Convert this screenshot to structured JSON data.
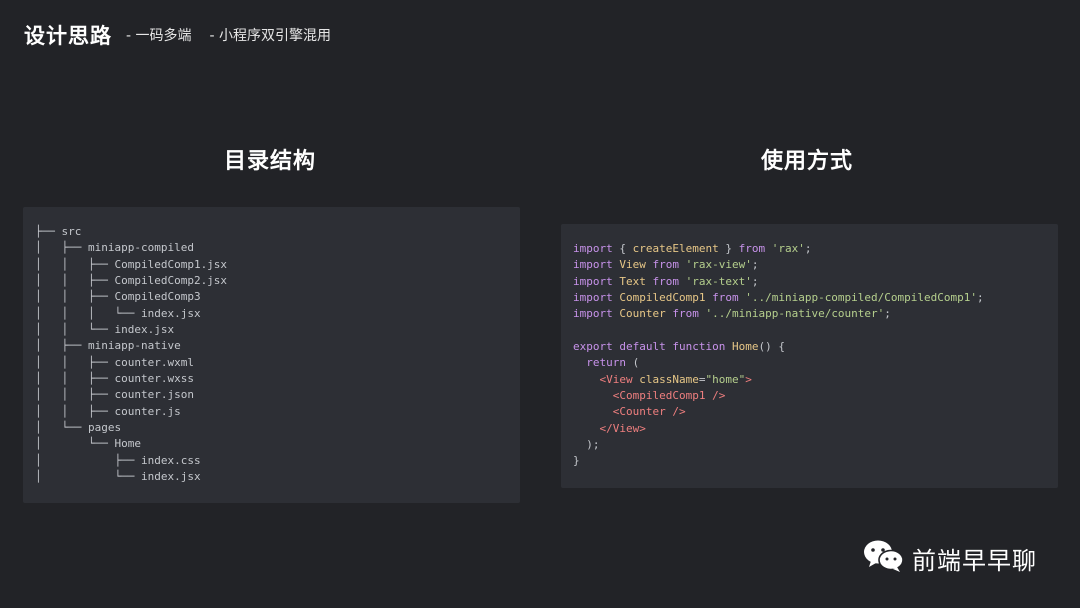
{
  "header": {
    "title": "设计思路",
    "subtitle_1": "- 一码多端",
    "subtitle_2": "- 小程序双引擎混用"
  },
  "sections": {
    "left_title": "目录结构",
    "right_title": "使用方式"
  },
  "tree_lines": [
    "├── src",
    "│   ├── miniapp-compiled",
    "│   │   ├── CompiledComp1.jsx",
    "│   │   ├── CompiledComp2.jsx",
    "│   │   ├── CompiledComp3",
    "│   │   │   └── index.jsx",
    "│   │   └── index.jsx",
    "│   ├── miniapp-native",
    "│   │   ├── counter.wxml",
    "│   │   ├── counter.wxss",
    "│   │   ├── counter.json",
    "│   │   ├── counter.js",
    "│   └── pages",
    "│       └── Home",
    "│           ├── index.css",
    "│           └── index.jsx"
  ],
  "code_lines": [
    [
      [
        "kw",
        "import"
      ],
      [
        "pl",
        " { "
      ],
      [
        "fn",
        "createElement"
      ],
      [
        "pl",
        " } "
      ],
      [
        "kw",
        "from"
      ],
      [
        "pl",
        " "
      ],
      [
        "str",
        "'rax'"
      ],
      [
        "pl",
        ";"
      ]
    ],
    [
      [
        "kw",
        "import"
      ],
      [
        "pl",
        " "
      ],
      [
        "fn",
        "View"
      ],
      [
        "pl",
        " "
      ],
      [
        "kw",
        "from"
      ],
      [
        "pl",
        " "
      ],
      [
        "str",
        "'rax-view'"
      ],
      [
        "pl",
        ";"
      ]
    ],
    [
      [
        "kw",
        "import"
      ],
      [
        "pl",
        " "
      ],
      [
        "fn",
        "Text"
      ],
      [
        "pl",
        " "
      ],
      [
        "kw",
        "from"
      ],
      [
        "pl",
        " "
      ],
      [
        "str",
        "'rax-text'"
      ],
      [
        "pl",
        ";"
      ]
    ],
    [
      [
        "kw",
        "import"
      ],
      [
        "pl",
        " "
      ],
      [
        "fn",
        "CompiledComp1"
      ],
      [
        "pl",
        " "
      ],
      [
        "kw",
        "from"
      ],
      [
        "pl",
        " "
      ],
      [
        "str",
        "'../miniapp-compiled/CompiledComp1'"
      ],
      [
        "pl",
        ";"
      ]
    ],
    [
      [
        "kw",
        "import"
      ],
      [
        "pl",
        " "
      ],
      [
        "fn",
        "Counter"
      ],
      [
        "pl",
        " "
      ],
      [
        "kw",
        "from"
      ],
      [
        "pl",
        " "
      ],
      [
        "str",
        "'../miniapp-native/counter'"
      ],
      [
        "pl",
        ";"
      ]
    ],
    [
      [
        "pl",
        ""
      ]
    ],
    [
      [
        "kw",
        "export"
      ],
      [
        "pl",
        " "
      ],
      [
        "kw",
        "default"
      ],
      [
        "pl",
        " "
      ],
      [
        "kw",
        "function"
      ],
      [
        "pl",
        " "
      ],
      [
        "fn",
        "Home"
      ],
      [
        "pl",
        "() {"
      ]
    ],
    [
      [
        "pl",
        "  "
      ],
      [
        "kw",
        "return"
      ],
      [
        "pl",
        " ("
      ]
    ],
    [
      [
        "pl",
        "    "
      ],
      [
        "tag",
        "<View"
      ],
      [
        "pl",
        " "
      ],
      [
        "attr",
        "className"
      ],
      [
        "pl",
        "="
      ],
      [
        "str",
        "\"home\""
      ],
      [
        "tag",
        ">"
      ]
    ],
    [
      [
        "pl",
        "      "
      ],
      [
        "tag",
        "<CompiledComp1 />"
      ]
    ],
    [
      [
        "pl",
        "      "
      ],
      [
        "tag",
        "<Counter />"
      ]
    ],
    [
      [
        "pl",
        "    "
      ],
      [
        "tag",
        "</View>"
      ]
    ],
    [
      [
        "pl",
        "  );"
      ]
    ],
    [
      [
        "pl",
        "}"
      ]
    ]
  ],
  "brand": {
    "name": "前端早早聊",
    "icon": "wechat-icon"
  }
}
